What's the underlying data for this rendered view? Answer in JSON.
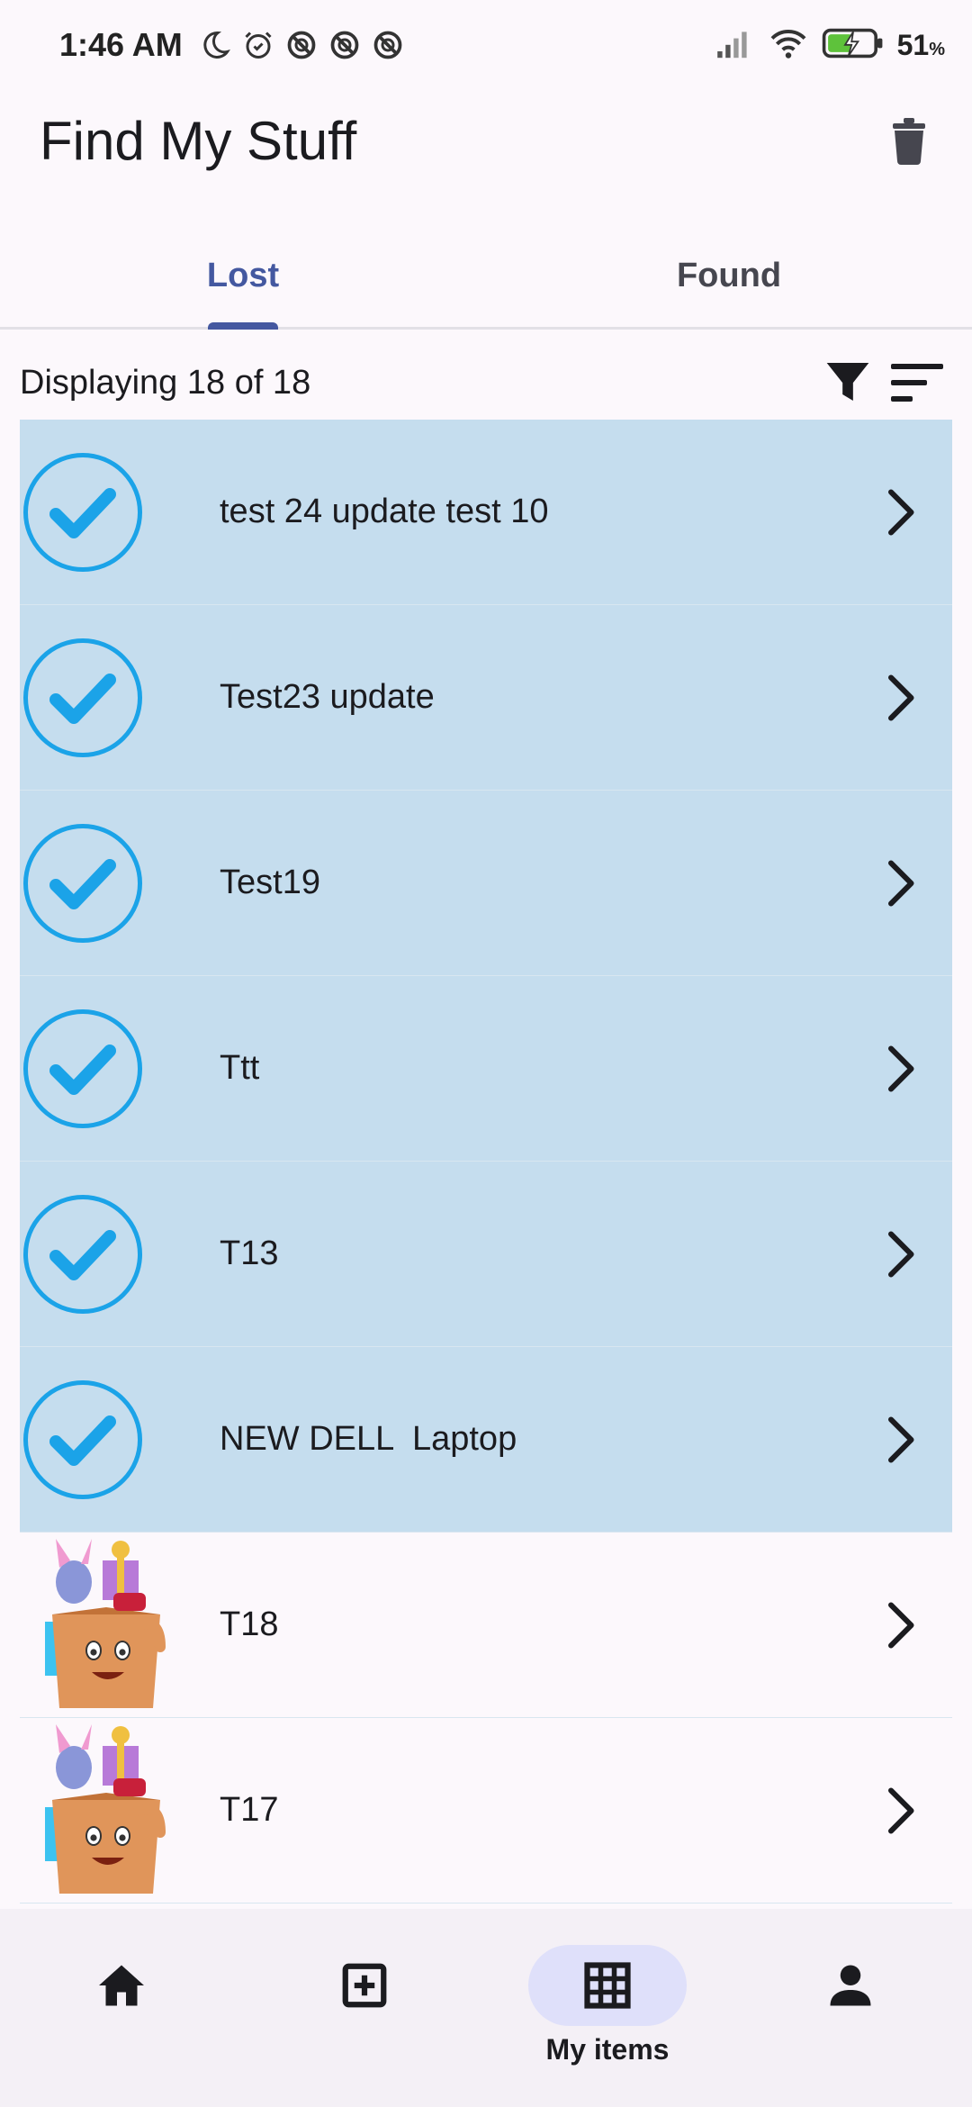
{
  "status_bar": {
    "time": "1:46 AM",
    "battery_percent": "51",
    "battery_unit": "%",
    "icons": [
      "moon-icon",
      "alarm-icon",
      "blocked-icon",
      "blocked-icon",
      "blocked-icon",
      "signal-icon",
      "wifi-icon",
      "battery-charging-icon"
    ]
  },
  "app_bar": {
    "title": "Find My Stuff",
    "action_icon": "trash-icon"
  },
  "tabs": [
    {
      "label": "Lost",
      "active": true
    },
    {
      "label": "Found",
      "active": false
    }
  ],
  "list_header": {
    "count_text": "Displaying 18 of 18",
    "filter_icon": "filter-icon",
    "sort_icon": "sort-icon"
  },
  "items": [
    {
      "title": "test 24 update test 10",
      "selected": true
    },
    {
      "title": "Test23 update",
      "selected": true
    },
    {
      "title": "Test19",
      "selected": true
    },
    {
      "title": "Ttt",
      "selected": true
    },
    {
      "title": "T13",
      "selected": true
    },
    {
      "title": "NEW DELL  Laptop",
      "selected": true
    },
    {
      "title": "T18",
      "selected": false
    },
    {
      "title": "T17",
      "selected": false
    }
  ],
  "bottom_nav": [
    {
      "icon": "home-icon",
      "label": "",
      "active": false
    },
    {
      "icon": "add-box-icon",
      "label": "",
      "active": false
    },
    {
      "icon": "grid-icon",
      "label": "My items",
      "active": true
    },
    {
      "icon": "person-icon",
      "label": "",
      "active": false
    }
  ],
  "colors": {
    "accent": "#4458a0",
    "selected_bg": "#c5ddee",
    "check": "#1ba3e8",
    "background": "#fcf8fc"
  }
}
